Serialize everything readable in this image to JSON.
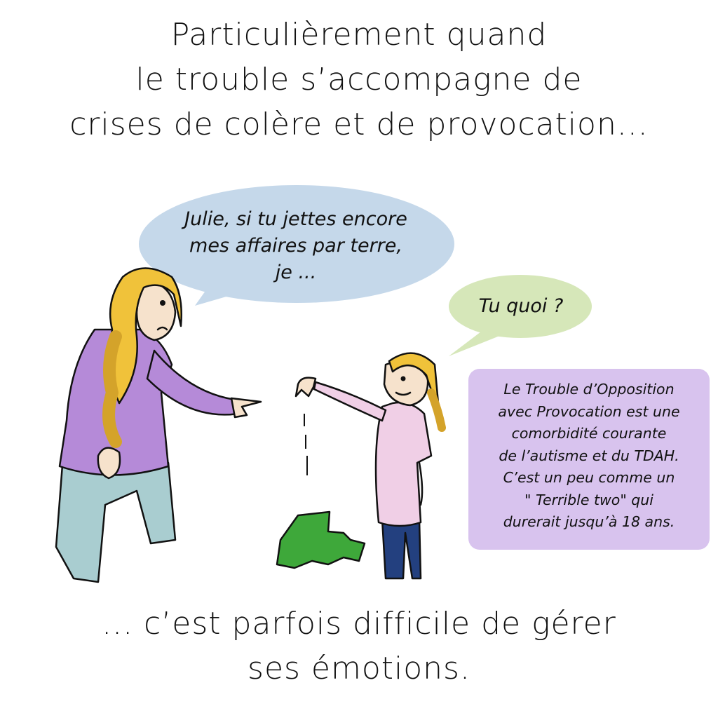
{
  "caption_top": {
    "line1": "Particulièrement quand",
    "line2": "le trouble s’accompagne de",
    "line3": "crises de colère et de provocation..."
  },
  "speech_mother": {
    "line1": "Julie, si tu jettes encore",
    "line2": "mes affaires par terre,",
    "line3": "je ..."
  },
  "speech_child": {
    "line1": "Tu quoi ?"
  },
  "info_box": {
    "line1": "Le Trouble d’Opposition",
    "line2": "avec Provocation est une",
    "line3": "comorbidité courante",
    "line4": "de l’autisme et du TDAH.",
    "line5": "C’est un peu comme un",
    "line6": "\" Terrible two\" qui",
    "line7": "durerait jusqu’à 18 ans."
  },
  "caption_bottom": {
    "line1": "... c’est parfois difficile de gérer",
    "line2": "ses émotions."
  },
  "colors": {
    "mother_bubble": "#c5d8ea",
    "child_bubble": "#d6e7b9",
    "info_box": "#d8c3ee",
    "hair": "#f0c23a",
    "mother_sweater": "#b58ad8",
    "mother_pants": "#a9cdd0",
    "child_shirt": "#f0cfe6",
    "child_pants": "#23407f",
    "clothing_on_floor": "#3ea83a"
  }
}
